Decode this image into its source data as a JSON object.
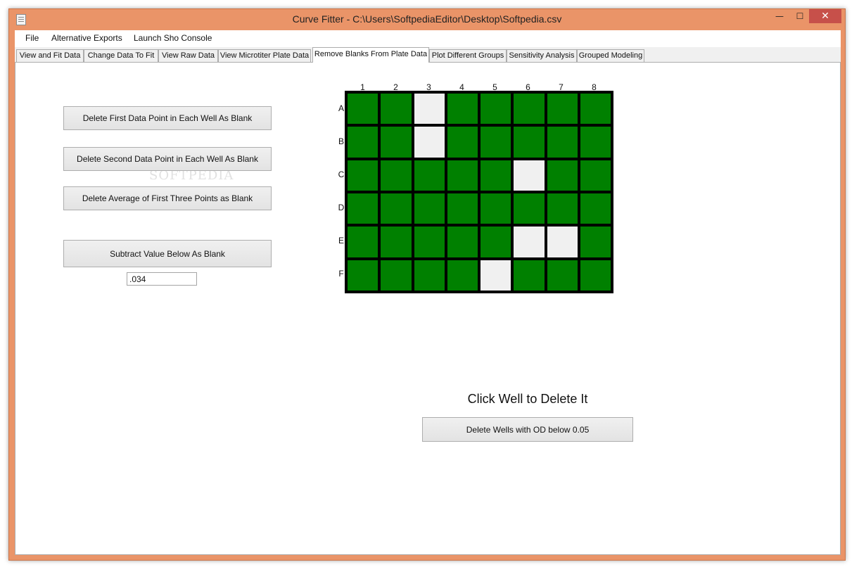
{
  "window": {
    "title": "Curve Fitter - C:\\Users\\SoftpediaEditor\\Desktop\\Softpedia.csv",
    "controls": {
      "minimize": "—",
      "maximize": "☐",
      "close": "✕"
    }
  },
  "menu": [
    "File",
    "Alternative Exports",
    "Launch Sho Console"
  ],
  "tabs": [
    "View and Fit Data",
    "Change Data To Fit",
    "View Raw Data",
    "View Microtiter Plate Data",
    "Remove Blanks From Plate Data",
    "Plot Different Groups",
    "Sensitivity Analysis",
    "Grouped Modeling"
  ],
  "active_tab": "Remove Blanks From Plate Data",
  "buttons": {
    "delete_first": "Delete First Data Point in Each Well As Blank",
    "delete_second": "Delete Second Data Point in Each Well As Blank",
    "delete_average": "Delete Average of First Three Points as Blank",
    "subtract_value": "Subtract Value Below As Blank",
    "delete_low_od": "Delete Wells with OD below 0.05"
  },
  "blank_value": ".034",
  "watermark": "SOFTPEDIA",
  "plate": {
    "columns": [
      "1",
      "2",
      "3",
      "4",
      "5",
      "6",
      "7",
      "8"
    ],
    "rows": [
      "A",
      "B",
      "C",
      "D",
      "E",
      "F"
    ],
    "deleted_wells": [
      "A3",
      "B3",
      "C6",
      "E6",
      "E7",
      "F5"
    ],
    "colors": {
      "active": "#008000",
      "deleted": "#f0f0f0",
      "frame": "#000000"
    }
  },
  "click_hint": "Click Well to Delete It"
}
